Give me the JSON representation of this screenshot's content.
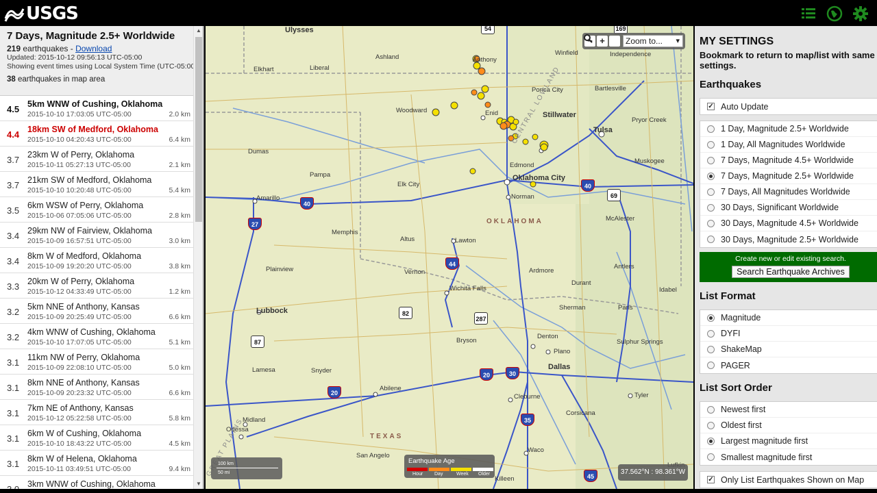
{
  "app": {
    "logo_text": "USGS"
  },
  "topbar": {
    "icons": [
      "list-icon",
      "globe-icon",
      "gear-icon"
    ],
    "accent": "#1f8a1f"
  },
  "list_panel": {
    "title": "7 Days, Magnitude 2.5+ Worldwide",
    "count": "219",
    "count_suffix": " earthquakes - ",
    "download_label": "Download",
    "updated": "Updated: 2015-10-12 09:56:13 UTC-05:00",
    "time_note": "Showing event times using Local System Time (UTC-05:00)",
    "area_count": "38",
    "area_suffix": " earthquakes in map area",
    "items": [
      {
        "mag": "4.5",
        "place": "5km WNW of Cushing, Oklahoma",
        "time": "2015-10-10 17:03:05 UTC-05:00",
        "depth": "2.0 km"
      },
      {
        "mag": "4.4",
        "place": "18km SW of Medford, Oklahoma",
        "time": "2015-10-10 04:20:43 UTC-05:00",
        "depth": "6.4 km"
      },
      {
        "mag": "3.7",
        "place": "23km W of Perry, Oklahoma",
        "time": "2015-10-11 05:27:13 UTC-05:00",
        "depth": "2.1 km"
      },
      {
        "mag": "3.7",
        "place": "21km SW of Medford, Oklahoma",
        "time": "2015-10-10 10:20:48 UTC-05:00",
        "depth": "5.4 km"
      },
      {
        "mag": "3.5",
        "place": "6km WSW of Perry, Oklahoma",
        "time": "2015-10-06 07:05:06 UTC-05:00",
        "depth": "2.8 km"
      },
      {
        "mag": "3.4",
        "place": "29km NW of Fairview, Oklahoma",
        "time": "2015-10-09 16:57:51 UTC-05:00",
        "depth": "3.0 km"
      },
      {
        "mag": "3.4",
        "place": "8km W of Medford, Oklahoma",
        "time": "2015-10-09 19:20:20 UTC-05:00",
        "depth": "3.8 km"
      },
      {
        "mag": "3.3",
        "place": "20km W of Perry, Oklahoma",
        "time": "2015-10-12 04:33:49 UTC-05:00",
        "depth": "1.2 km"
      },
      {
        "mag": "3.2",
        "place": "5km NNE of Anthony, Kansas",
        "time": "2015-10-09 20:25:49 UTC-05:00",
        "depth": "6.6 km"
      },
      {
        "mag": "3.2",
        "place": "4km WNW of Cushing, Oklahoma",
        "time": "2015-10-10 17:07:05 UTC-05:00",
        "depth": "5.1 km"
      },
      {
        "mag": "3.1",
        "place": "11km NW of Perry, Oklahoma",
        "time": "2015-10-09 22:08:10 UTC-05:00",
        "depth": "5.0 km"
      },
      {
        "mag": "3.1",
        "place": "8km NNE of Anthony, Kansas",
        "time": "2015-10-09 20:23:32 UTC-05:00",
        "depth": "6.6 km"
      },
      {
        "mag": "3.1",
        "place": "7km NE of Anthony, Kansas",
        "time": "2015-10-12 05:22:58 UTC-05:00",
        "depth": "5.8 km"
      },
      {
        "mag": "3.1",
        "place": "6km W of Cushing, Oklahoma",
        "time": "2015-10-10 18:43:22 UTC-05:00",
        "depth": "4.5 km"
      },
      {
        "mag": "3.1",
        "place": "8km W of Helena, Oklahoma",
        "time": "2015-10-11 03:49:51 UTC-05:00",
        "depth": "9.4 km"
      },
      {
        "mag": "3.0",
        "place": "3km WNW of Cushing, Oklahoma",
        "time": "",
        "depth": ""
      }
    ]
  },
  "map": {
    "zoom_placeholder": "Zoom to...",
    "zoom_out": "−",
    "zoom_in": "+",
    "scale_km": "100 km",
    "scale_mi": "50 mi",
    "legend_title": "Earthquake Age",
    "legend_labels": [
      "Hour",
      "Day",
      "Week",
      "Older"
    ],
    "legend_colors": [
      "#d40000",
      "#ff8c1a",
      "#f5e000",
      "#ffffff"
    ],
    "coords": "37.562°N : 98.361°W",
    "state_labels": [
      "OKLAHOMA",
      "TEXAS"
    ],
    "region_labels": [
      "CENTRAL LOWLAND",
      "GREAT PLAINS"
    ],
    "cities": [
      "Ulysses",
      "Ashland",
      "Anthony",
      "Winfield",
      "Independence",
      "Elkhart",
      "Liberal",
      "Ponca City",
      "Bartlesville",
      "Woodward",
      "Enid",
      "Stillwater",
      "Tulsa",
      "Pryor Creek",
      "Dumas",
      "Edmond",
      "Muskogee",
      "Pampa",
      "Elk City",
      "Oklahoma City",
      "Amarillo",
      "Norman",
      "McAlester",
      "Memphis",
      "Altus",
      "Lawton",
      "Plainview",
      "Vernon",
      "Ardmore",
      "Antlers",
      "Wichita Falls",
      "Durant",
      "Idabel",
      "Paris",
      "Lubbock",
      "Sherman",
      "Denton",
      "Bryson",
      "Sulphur Springs",
      "Plano",
      "Dallas",
      "Lamesa",
      "Snyder",
      "Abilene",
      "Cleburne",
      "Tyler",
      "Midland",
      "Odessa",
      "Corsicana",
      "San Angelo",
      "Waco",
      "Killeen",
      "Lufkin"
    ],
    "highway_shields": [
      "54",
      "169",
      "40",
      "69",
      "27",
      "40",
      "82",
      "287",
      "87",
      "20",
      "30",
      "35",
      "45",
      "20",
      "44"
    ]
  },
  "settings": {
    "title": "MY SETTINGS",
    "subtitle_1": "Bookmark to return to map/list with same",
    "subtitle_2": "settings.",
    "earthquakes_heading": "Earthquakes",
    "auto_update": "Auto Update",
    "feeds": [
      "1 Day, Magnitude 2.5+ Worldwide",
      "1 Day, All Magnitudes Worldwide",
      "7 Days, Magnitude 4.5+ Worldwide",
      "7 Days, Magnitude 2.5+ Worldwide",
      "7 Days, All Magnitudes Worldwide",
      "30 Days, Significant Worldwide",
      "30 Days, Magnitude 4.5+ Worldwide",
      "30 Days, Magnitude 2.5+ Worldwide"
    ],
    "selected_feed": 3,
    "search_note": "Create new or edit existing search.",
    "search_button": "Search Earthquake Archives",
    "list_format_heading": "List Format",
    "list_formats": [
      "Magnitude",
      "DYFI",
      "ShakeMap",
      "PAGER"
    ],
    "selected_format": 0,
    "sort_heading": "List Sort Order",
    "sort_options": [
      "Newest first",
      "Oldest first",
      "Largest magnitude first",
      "Smallest magnitude first"
    ],
    "selected_sort": 2,
    "only_list_label": "Only List Earthquakes Shown on Map"
  }
}
